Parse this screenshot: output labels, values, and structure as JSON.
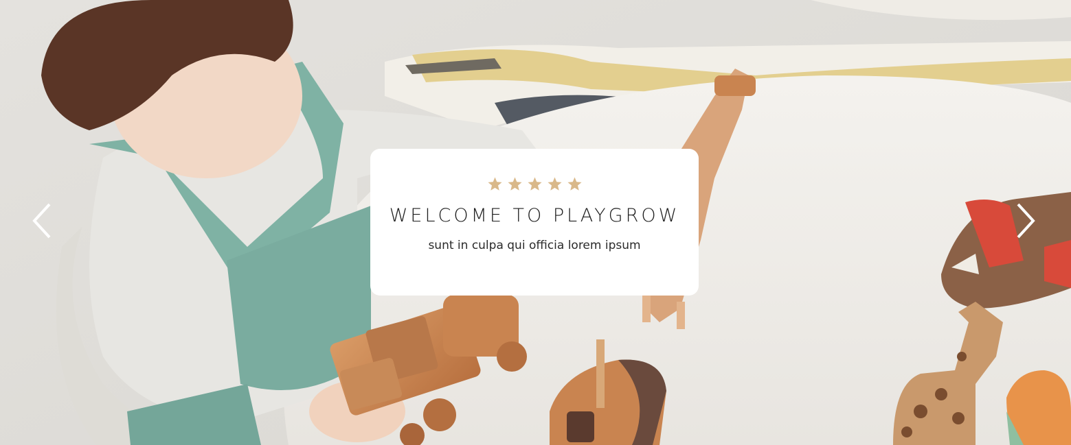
{
  "slide": {
    "rating_stars": 5,
    "title": "WELCOME TO PLAYGROW",
    "subtitle": "sunt in culpa qui officia lorem ipsum"
  },
  "colors": {
    "star": "#d9b889",
    "card": "#ffffff",
    "arrow": "#ffffff"
  },
  "icons": {
    "prev": "chevron-left-icon",
    "next": "chevron-right-icon",
    "rating": "star-icon"
  }
}
